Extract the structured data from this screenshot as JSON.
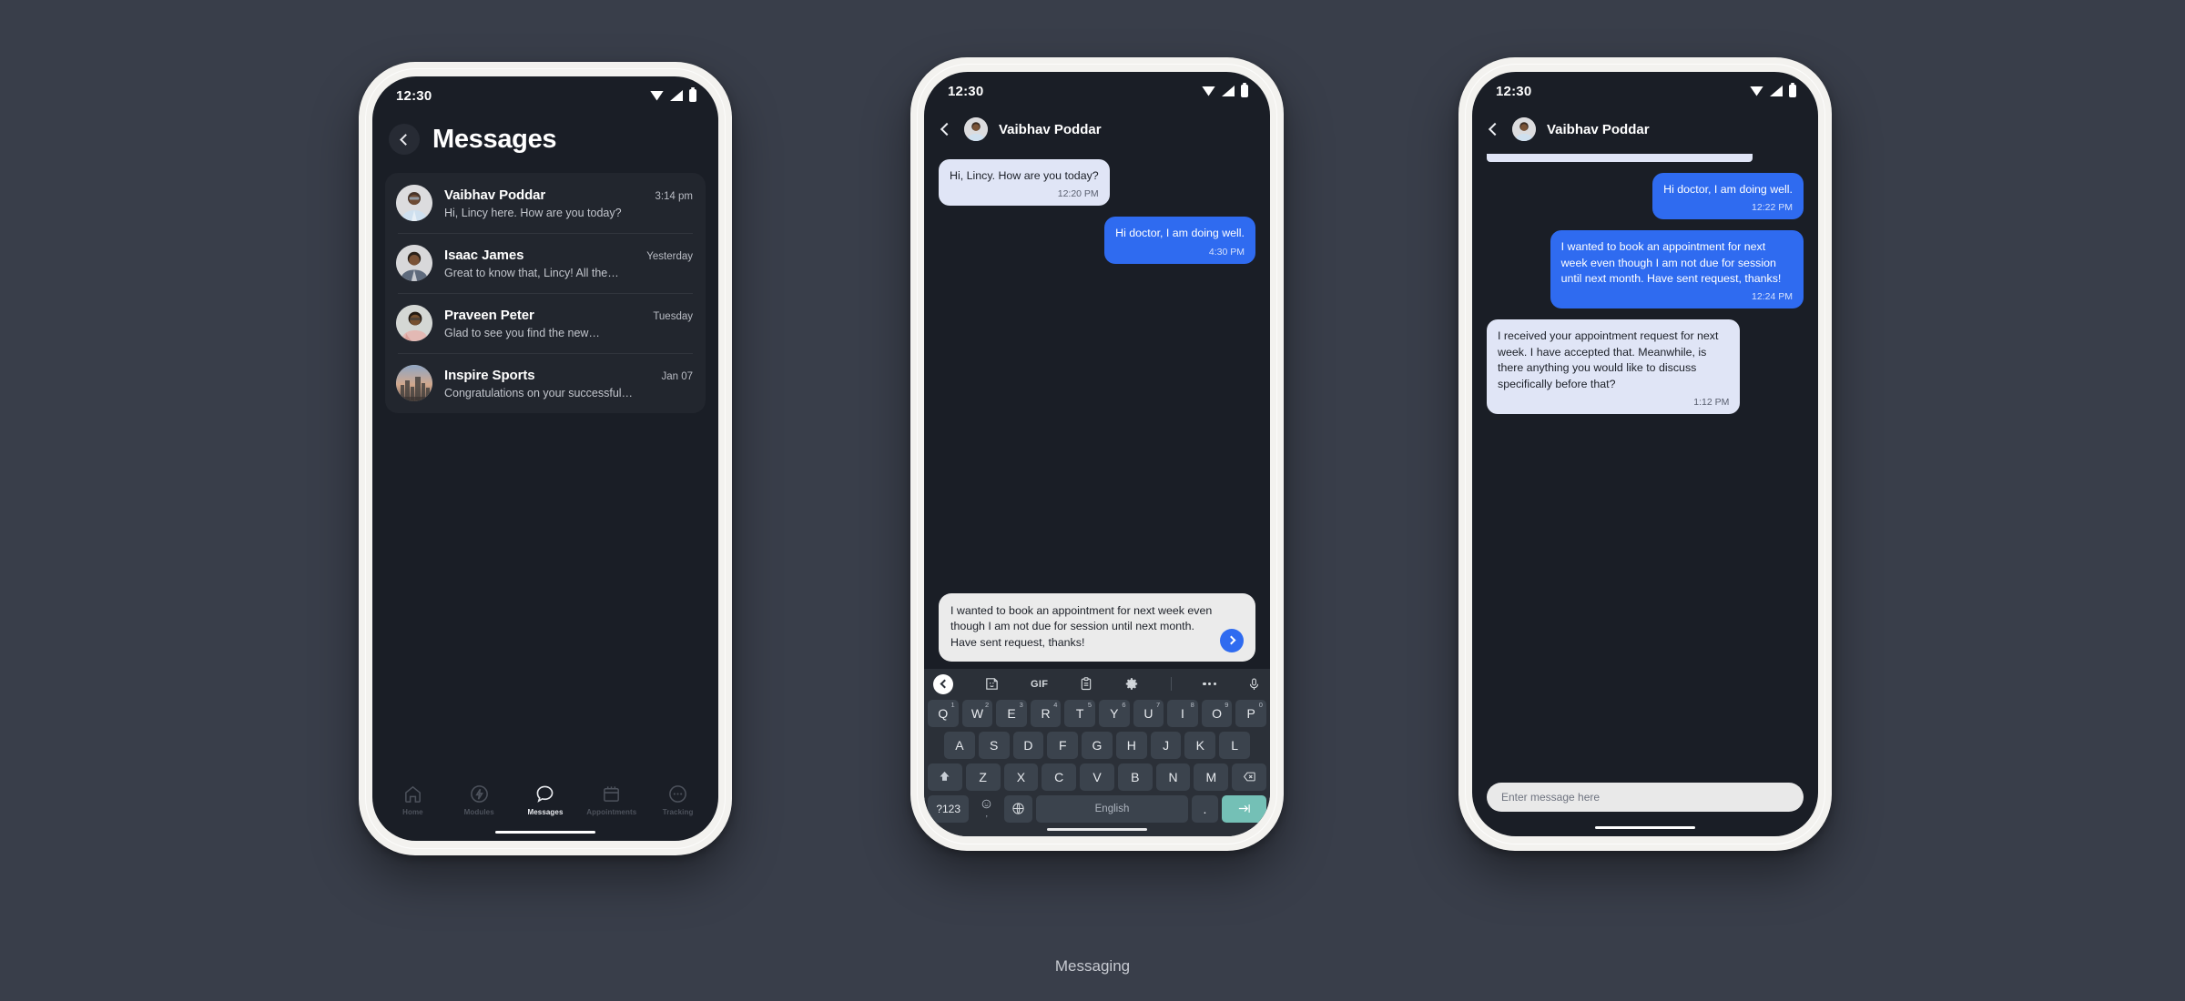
{
  "caption": "Messaging",
  "colors": {
    "page_bg": "#393e4a",
    "screen_bg": "#1a1e26",
    "card_bg": "#22262e",
    "bubble_in": "#e0e5f6",
    "bubble_out": "#2f6bf0",
    "accent_blue": "#2f6bf0",
    "enter_key": "#74c0b6",
    "keyboard_bg": "#2b3038",
    "key_bg": "#3b434d"
  },
  "status_bar": {
    "time": "12:30",
    "icons": [
      "wifi-icon",
      "signal-icon",
      "battery-icon"
    ]
  },
  "phone1": {
    "title": "Messages",
    "back_icon": "chevron-left-icon",
    "conversations": [
      {
        "name": "Vaibhav Poddar",
        "time": "3:14 pm",
        "preview": "Hi, Lincy here. How are you today?"
      },
      {
        "name": "Isaac James",
        "time": "Yesterday",
        "preview": "Great to know that, Lincy! All the…"
      },
      {
        "name": "Praveen Peter",
        "time": "Tuesday",
        "preview": "Glad to see you find the new…"
      },
      {
        "name": "Inspire Sports",
        "time": "Jan 07",
        "preview": "Congratulations on your successful…"
      }
    ],
    "bottom_nav": [
      {
        "label": "Home",
        "icon": "home-icon",
        "active": false
      },
      {
        "label": "Modules",
        "icon": "bolt-circle-icon",
        "active": false
      },
      {
        "label": "Messages",
        "icon": "chat-bubble-icon",
        "active": true
      },
      {
        "label": "Appointments",
        "icon": "calendar-icon",
        "active": false
      },
      {
        "label": "Tracking",
        "icon": "dots-circle-icon",
        "active": false
      }
    ]
  },
  "phone2": {
    "contact_name": "Vaibhav Poddar",
    "back_icon": "chevron-left-icon",
    "messages": [
      {
        "side": "in",
        "text": "Hi, Lincy. How are you today?",
        "time": "12:20 PM"
      },
      {
        "side": "out",
        "text": "Hi doctor, I am doing well.",
        "time": "4:30 PM"
      }
    ],
    "compose": {
      "value": "I wanted to book an appointment for next week even though I am not due for session until next month. Have sent request, thanks!",
      "send_icon": "send-chevron-icon"
    },
    "keyboard": {
      "toolbar": [
        "back-icon",
        "sticker-icon",
        "GIF",
        "clipboard-icon",
        "gear-icon",
        "overflow-dots-icon",
        "microphone-icon"
      ],
      "gif_label": "GIF",
      "row1": [
        {
          "key": "Q",
          "num": "1"
        },
        {
          "key": "W",
          "num": "2"
        },
        {
          "key": "E",
          "num": "3"
        },
        {
          "key": "R",
          "num": "4"
        },
        {
          "key": "T",
          "num": "5"
        },
        {
          "key": "Y",
          "num": "6"
        },
        {
          "key": "U",
          "num": "7"
        },
        {
          "key": "I",
          "num": "8"
        },
        {
          "key": "O",
          "num": "9"
        },
        {
          "key": "P",
          "num": "0"
        }
      ],
      "row2": [
        "A",
        "S",
        "D",
        "F",
        "G",
        "H",
        "J",
        "K",
        "L"
      ],
      "row3": [
        "Z",
        "X",
        "C",
        "V",
        "B",
        "N",
        "M"
      ],
      "shift_icon": "shift-icon",
      "backspace_icon": "backspace-icon",
      "numeric_label": "?123",
      "emoji_icon": "emoji-icon",
      "comma_label": ",",
      "globe_icon": "globe-icon",
      "space_label": "English",
      "period_label": ".",
      "enter_icon": "enter-icon"
    }
  },
  "phone3": {
    "contact_name": "Vaibhav Poddar",
    "back_icon": "chevron-left-icon",
    "messages": [
      {
        "side": "out",
        "text": "Hi doctor, I am doing well.",
        "time": "12:22 PM"
      },
      {
        "side": "out",
        "text": "I wanted to book an appointment for next week even though I am not due for session until next month. Have sent request, thanks!",
        "time": "12:24 PM"
      },
      {
        "side": "in",
        "text": "I received your appointment request for next week. I have accepted that. Meanwhile, is there anything you would like to discuss specifically before that?",
        "time": "1:12 PM"
      }
    ],
    "input_placeholder": "Enter message here"
  }
}
